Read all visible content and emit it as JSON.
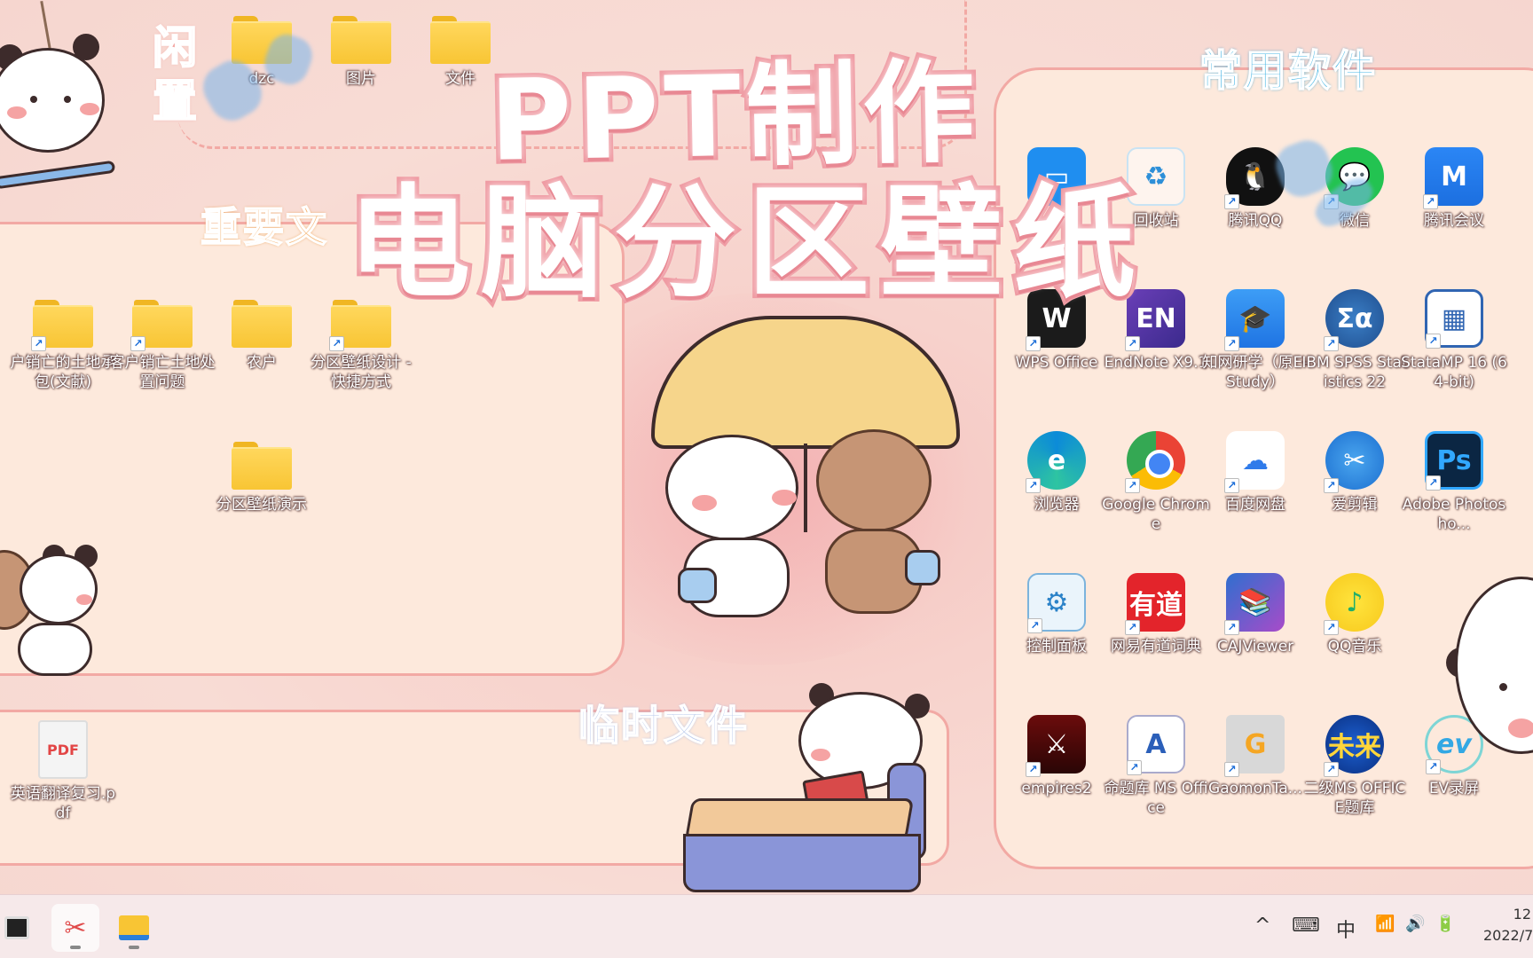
{
  "overlay": {
    "title_line1": "PPT制作",
    "title_line2": "电脑分区壁纸"
  },
  "zones": {
    "idle": "闲置",
    "important": "重要文",
    "temp": "临时文件",
    "software": "常用软件"
  },
  "idle_icons": [
    {
      "label": "dzc"
    },
    {
      "label": "图片"
    },
    {
      "label": "文件"
    }
  ],
  "important_icons": [
    {
      "label": "户销亡的土地承包(文献)"
    },
    {
      "label": "客户销亡土地处置问题"
    },
    {
      "label": "农户"
    },
    {
      "label": "分区壁纸设计 - 快捷方式"
    },
    {
      "label": "分区壁纸演示"
    }
  ],
  "temp_icons": [
    {
      "label": "英语翻译复习.pdf",
      "glyph": "PDF"
    }
  ],
  "software_icons": [
    {
      "label": "",
      "glyph": "▭"
    },
    {
      "label": "回收站",
      "glyph": "♻"
    },
    {
      "label": "腾讯QQ",
      "glyph": "🐧"
    },
    {
      "label": "微信",
      "glyph": "💬"
    },
    {
      "label": "腾讯会议",
      "glyph": "M"
    },
    {
      "label": "WPS Office",
      "glyph": "W"
    },
    {
      "label": "EndNote X9.1",
      "glyph": "EN"
    },
    {
      "label": "知网研学（原E-Study）",
      "glyph": "🎓"
    },
    {
      "label": "IBM SPSS Statistics 22",
      "glyph": "Σα"
    },
    {
      "label": "StataMP 16 (64-bit)",
      "glyph": "▦"
    },
    {
      "label": "浏览器",
      "glyph": "e"
    },
    {
      "label": "Google Chrome",
      "glyph": ""
    },
    {
      "label": "百度网盘",
      "glyph": "☁"
    },
    {
      "label": "爱剪辑",
      "glyph": "✂"
    },
    {
      "label": "Adobe Photosho...",
      "glyph": "Ps"
    },
    {
      "label": "控制面板",
      "glyph": "⚙"
    },
    {
      "label": "网易有道词典",
      "glyph": "有道"
    },
    {
      "label": "CAJViewer",
      "glyph": "📚"
    },
    {
      "label": "QQ音乐",
      "glyph": "♪"
    },
    {
      "label": "empires2",
      "glyph": "⚔"
    },
    {
      "label": "命题库 MS Office",
      "glyph": "A"
    },
    {
      "label": "GaomonTa...",
      "glyph": "G"
    },
    {
      "label": "二级MS OFFICE题库",
      "glyph": "未来"
    },
    {
      "label": "EV录屏",
      "glyph": "ev"
    }
  ],
  "taskbar": {
    "tray_chevron": "^",
    "tray_keyboard": "⌨",
    "tray_ime": "中",
    "tray_wifi": "📶",
    "tray_volume": "🔊",
    "tray_battery": "🔋",
    "clock_time": "12",
    "clock_date": "2022/7"
  }
}
